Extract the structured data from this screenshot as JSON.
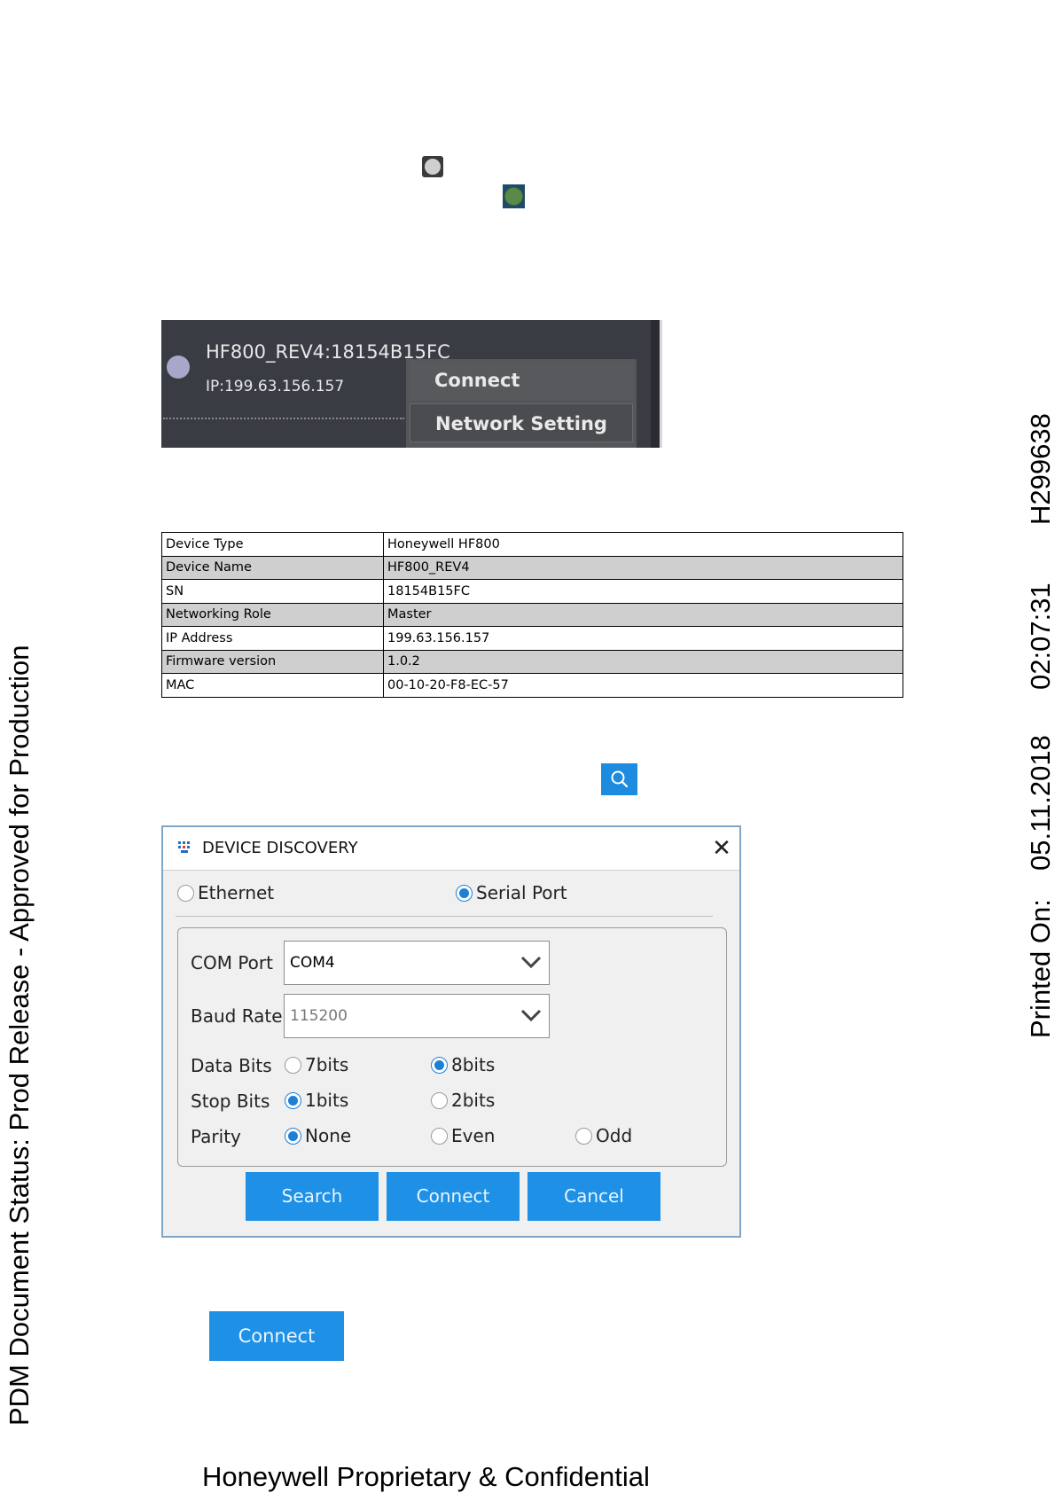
{
  "device_card": {
    "title": "HF800_REV4:18154B15FC",
    "ip": "IP:199.63.156.157",
    "menu": {
      "connect": "Connect",
      "network_setting": "Network Setting"
    }
  },
  "info_table": [
    {
      "key": "Device Type",
      "value": "Honeywell HF800"
    },
    {
      "key": "Device Name",
      "value": "HF800_REV4"
    },
    {
      "key": "SN",
      "value": "18154B15FC"
    },
    {
      "key": "Networking Role",
      "value": "Master"
    },
    {
      "key": "IP Address",
      "value": "199.63.156.157"
    },
    {
      "key": "Firmware version",
      "value": "1.0.2"
    },
    {
      "key": "MAC",
      "value": "00-10-20-F8-EC-57"
    }
  ],
  "dialog": {
    "title": "DEVICE DISCOVERY",
    "close": "✕",
    "connection": {
      "ethernet": "Ethernet",
      "serial": "Serial Port",
      "selected": "Serial Port"
    },
    "com_port": {
      "label": "COM Port",
      "value": "COM4"
    },
    "baud_rate": {
      "label": "Baud Rate",
      "value": "115200"
    },
    "data_bits": {
      "label": "Data Bits",
      "options": [
        "7bits",
        "8bits"
      ],
      "selected": "8bits"
    },
    "stop_bits": {
      "label": "Stop Bits",
      "options": [
        "1bits",
        "2bits"
      ],
      "selected": "1bits"
    },
    "parity": {
      "label": "Parity",
      "options": [
        "None",
        "Even",
        "Odd"
      ],
      "selected": "None"
    },
    "buttons": {
      "search": "Search",
      "connect": "Connect",
      "cancel": "Cancel"
    }
  },
  "connect_button": "Connect",
  "footer": "Honeywell Proprietary & Confidential",
  "margin": {
    "status": "PDM Document Status: Prod Release - Approved for Production",
    "printed_label": "Printed On:",
    "printed_date": "05.11.2018",
    "printed_time": "02:07:31",
    "doc_number": "H299638"
  },
  "colors": {
    "accent": "#1e90e5",
    "dark_panel": "#3a3c44",
    "status_green": "#5a8a4a",
    "status_gray": "#cfcfcf"
  }
}
